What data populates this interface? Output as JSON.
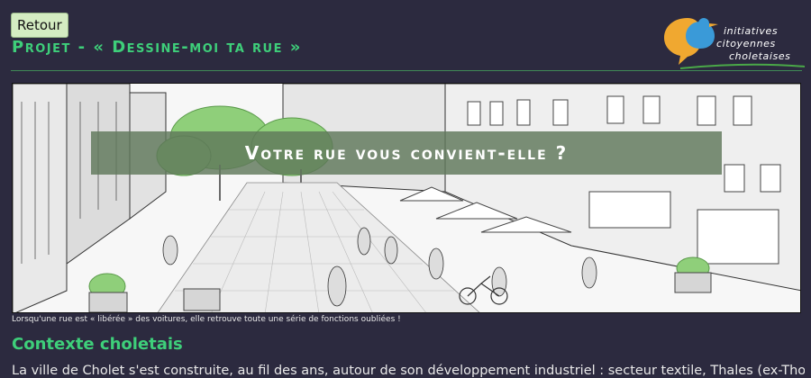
{
  "header": {
    "back_label": "Retour",
    "title": "Projet - « Dessine-moi ta rue »"
  },
  "logo": {
    "line1": "initiatives",
    "line2": "citoyennes",
    "line3": "choletaises"
  },
  "hero": {
    "banner_text": "Votre rue vous convient-elle ?",
    "caption": "Lorsqu'une rue est  « libérée »  des voitures, elle retrouve toute une série de fonctions oubliées !"
  },
  "section": {
    "heading": "Contexte choletais",
    "paragraph": "La ville de Cholet s'est construite, au fil des ans, autour de son développement industriel : secteur textile, Thales (ex-Thomson-Csf), l'agro-"
  },
  "colors": {
    "background": "#2c2a3f",
    "accent_green": "#3ecf7a",
    "button_bg": "#d4ecc2",
    "logo_orange": "#f0a830",
    "logo_blue": "#3a9ad8",
    "logo_green": "#4aa848"
  }
}
